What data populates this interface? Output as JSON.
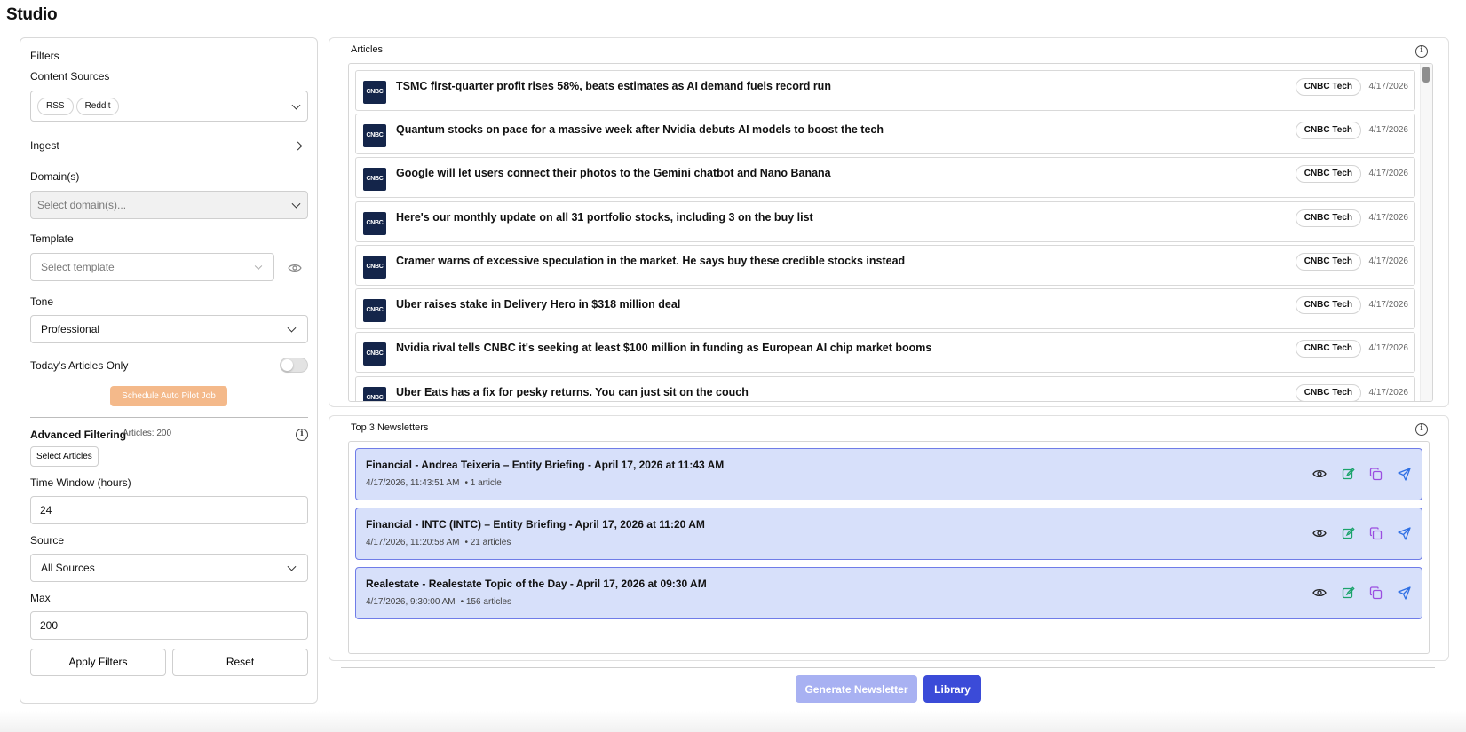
{
  "app": {
    "title": "Studio"
  },
  "filters": {
    "title": "Filters",
    "content_sources": {
      "label": "Content Sources",
      "chips": [
        "RSS",
        "Reddit"
      ]
    },
    "ingest": {
      "label": "Ingest"
    },
    "domains": {
      "label": "Domain(s)",
      "placeholder": "Select domain(s)..."
    },
    "template": {
      "label": "Template",
      "placeholder": "Select template"
    },
    "tone": {
      "label": "Tone",
      "value": "Professional"
    },
    "todays_only": {
      "label": "Today's Articles Only",
      "enabled": false
    },
    "autopilot": {
      "label": "Schedule Auto Pilot Job"
    },
    "advanced": {
      "label": "Advanced Filtering",
      "count_label": "Articles: 200",
      "select_articles": "Select Articles",
      "time_window": {
        "label": "Time Window (hours)",
        "value": "24"
      },
      "source": {
        "label": "Source",
        "value": "All Sources"
      },
      "max": {
        "label": "Max",
        "value": "200"
      },
      "apply": "Apply Filters",
      "reset": "Reset"
    }
  },
  "articles": {
    "title": "Articles",
    "items": [
      {
        "logo": "CNBC",
        "title": "TSMC first-quarter profit rises 58%, beats estimates as AI demand fuels record run",
        "source": "CNBC Tech",
        "date": "4/17/2026"
      },
      {
        "logo": "CNBC",
        "title": "Quantum stocks on pace for a massive week after Nvidia debuts AI models to boost the tech",
        "source": "CNBC Tech",
        "date": "4/17/2026"
      },
      {
        "logo": "CNBC",
        "title": "Google will let users connect their photos to the Gemini chatbot and Nano Banana",
        "source": "CNBC Tech",
        "date": "4/17/2026"
      },
      {
        "logo": "CNBC",
        "title": "Here's our monthly update on all 31 portfolio stocks, including 3 on the buy list",
        "source": "CNBC Tech",
        "date": "4/17/2026"
      },
      {
        "logo": "CNBC",
        "title": "Cramer warns of excessive speculation in the market. He says buy these credible stocks instead",
        "source": "CNBC Tech",
        "date": "4/17/2026"
      },
      {
        "logo": "CNBC",
        "title": "Uber raises stake in Delivery Hero in $318 million deal",
        "source": "CNBC Tech",
        "date": "4/17/2026"
      },
      {
        "logo": "CNBC",
        "title": "Nvidia rival tells CNBC it's seeking at least $100 million in funding as European AI chip market booms",
        "source": "CNBC Tech",
        "date": "4/17/2026"
      },
      {
        "logo": "CNBC",
        "title": "Uber Eats has a fix for pesky returns. You can just sit on the couch",
        "source": "CNBC Tech",
        "date": "4/17/2026"
      }
    ]
  },
  "newsletters": {
    "title": "Top 3 Newsletters",
    "items": [
      {
        "title": "Financial - Andrea Teixeria – Entity Briefing - April 17, 2026 at 11:43 AM",
        "timestamp": "4/17/2026, 11:43:51 AM",
        "count": "• 1 article"
      },
      {
        "title": "Financial - INTC (INTC) – Entity Briefing - April 17, 2026 at 11:20 AM",
        "timestamp": "4/17/2026, 11:20:58 AM",
        "count": "• 21 articles"
      },
      {
        "title": "Realestate - Realestate Topic of the Day - April 17, 2026 at 09:30 AM",
        "timestamp": "4/17/2026, 9:30:00 AM",
        "count": "• 156 articles"
      }
    ]
  },
  "footer": {
    "generate": "Generate Newsletter",
    "library": "Library"
  },
  "colors": {
    "accent": "#3b4bd8",
    "accent_disabled": "#a8b1f2",
    "autopilot": "#f4b98a",
    "newsletter_bg": "#d7e0fa",
    "newsletter_border": "#6f7ce8",
    "logo_bg": "#14254a"
  }
}
